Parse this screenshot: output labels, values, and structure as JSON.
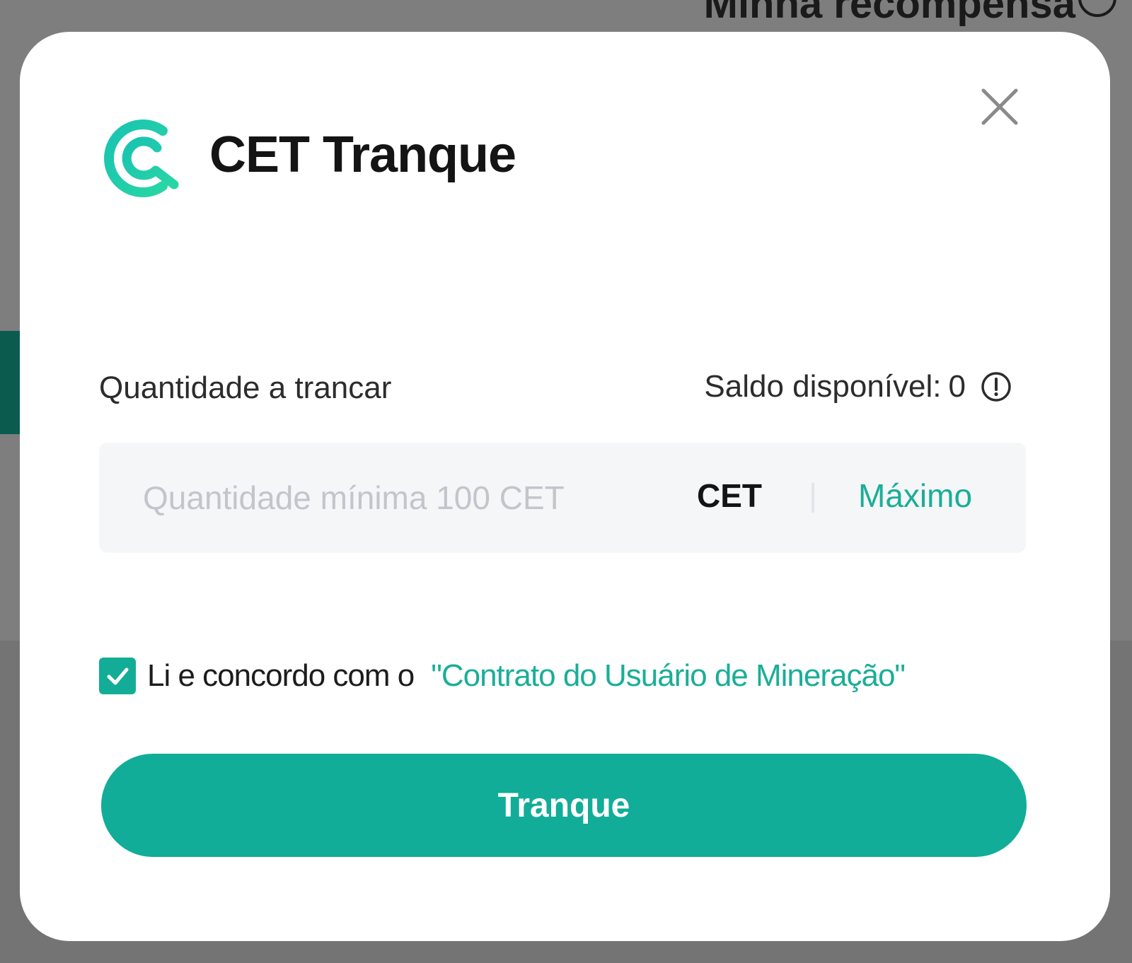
{
  "background": {
    "top_text": "Minha recompensa"
  },
  "modal": {
    "title": "CET Tranque",
    "field_label": "Quantidade a trancar",
    "balance_label": "Saldo disponível:",
    "balance_value": "0",
    "input": {
      "value": "",
      "placeholder": "Quantidade mínima 100 CET"
    },
    "unit": "CET",
    "max_label": "Máximo",
    "agreement": {
      "checked": true,
      "text": "Li e concordo com o",
      "link": "\"Contrato do Usuário de Mineração\""
    },
    "submit_label": "Tranque"
  },
  "colors": {
    "accent": "#11ad98",
    "link": "#1aae97",
    "overlay": "#7e7e7e"
  },
  "icons": [
    "coinex-logo-icon",
    "close-icon",
    "info-icon",
    "check-icon"
  ]
}
